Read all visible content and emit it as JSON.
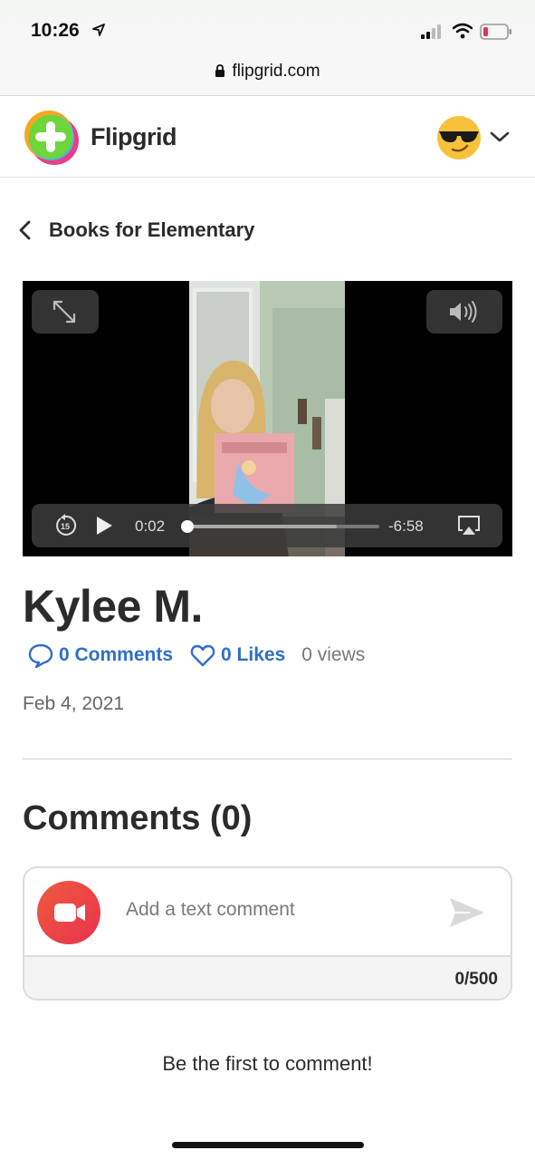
{
  "status_bar": {
    "time": "10:26",
    "url": "flipgrid.com"
  },
  "header": {
    "brand": "Flipgrid",
    "avatar_icon": "sunglasses-emoji-icon"
  },
  "breadcrumb": {
    "label": "Books for Elementary"
  },
  "video": {
    "current_time": "0:02",
    "remaining_time": "-6:58",
    "progress_fraction": 0.01,
    "buffered_fraction": 0.78
  },
  "response": {
    "author": "Kylee M.",
    "comments_label": "0 Comments",
    "likes_label": "0 Likes",
    "views_label": "0 views",
    "date": "Feb 4, 2021"
  },
  "comments": {
    "title": "Comments (0)",
    "input_placeholder": "Add a text comment",
    "char_counter": "0/500",
    "empty_message": "Be the first to comment!"
  },
  "colors": {
    "link_blue": "#2f6fc6",
    "record_red": "#e8334f"
  }
}
